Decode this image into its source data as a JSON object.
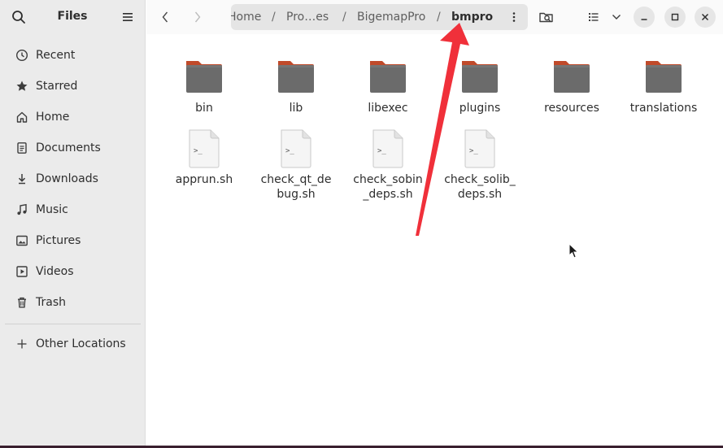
{
  "sidebar": {
    "title": "Files",
    "items": [
      {
        "label": "Recent",
        "icon": "clock-icon"
      },
      {
        "label": "Starred",
        "icon": "star-icon"
      },
      {
        "label": "Home",
        "icon": "home-icon"
      },
      {
        "label": "Documents",
        "icon": "document-icon"
      },
      {
        "label": "Downloads",
        "icon": "download-icon"
      },
      {
        "label": "Music",
        "icon": "music-icon"
      },
      {
        "label": "Pictures",
        "icon": "picture-icon"
      },
      {
        "label": "Videos",
        "icon": "video-icon"
      },
      {
        "label": "Trash",
        "icon": "trash-icon"
      }
    ],
    "other_locations": "Other Locations"
  },
  "pathbar": {
    "crumbs": [
      "Home",
      "Pro…es",
      "BigemapPro",
      "bmpro"
    ],
    "separator": "/"
  },
  "files": [
    {
      "name": "bin",
      "type": "folder"
    },
    {
      "name": "lib",
      "type": "folder"
    },
    {
      "name": "libexec",
      "type": "folder"
    },
    {
      "name": "plugins",
      "type": "folder"
    },
    {
      "name": "resources",
      "type": "folder"
    },
    {
      "name": "translations",
      "type": "folder"
    },
    {
      "name": "apprun.sh",
      "type": "script"
    },
    {
      "name": "check_qt_de bug.sh",
      "type": "script"
    },
    {
      "name": "check_sobin _deps.sh",
      "type": "script"
    },
    {
      "name": "check_solib_ deps.sh",
      "type": "script"
    }
  ],
  "script_glyph": ">_",
  "colors": {
    "folder_tab": "#c04a2a",
    "folder_body": "#6b6b6b",
    "annotation_arrow": "#f0303a"
  }
}
